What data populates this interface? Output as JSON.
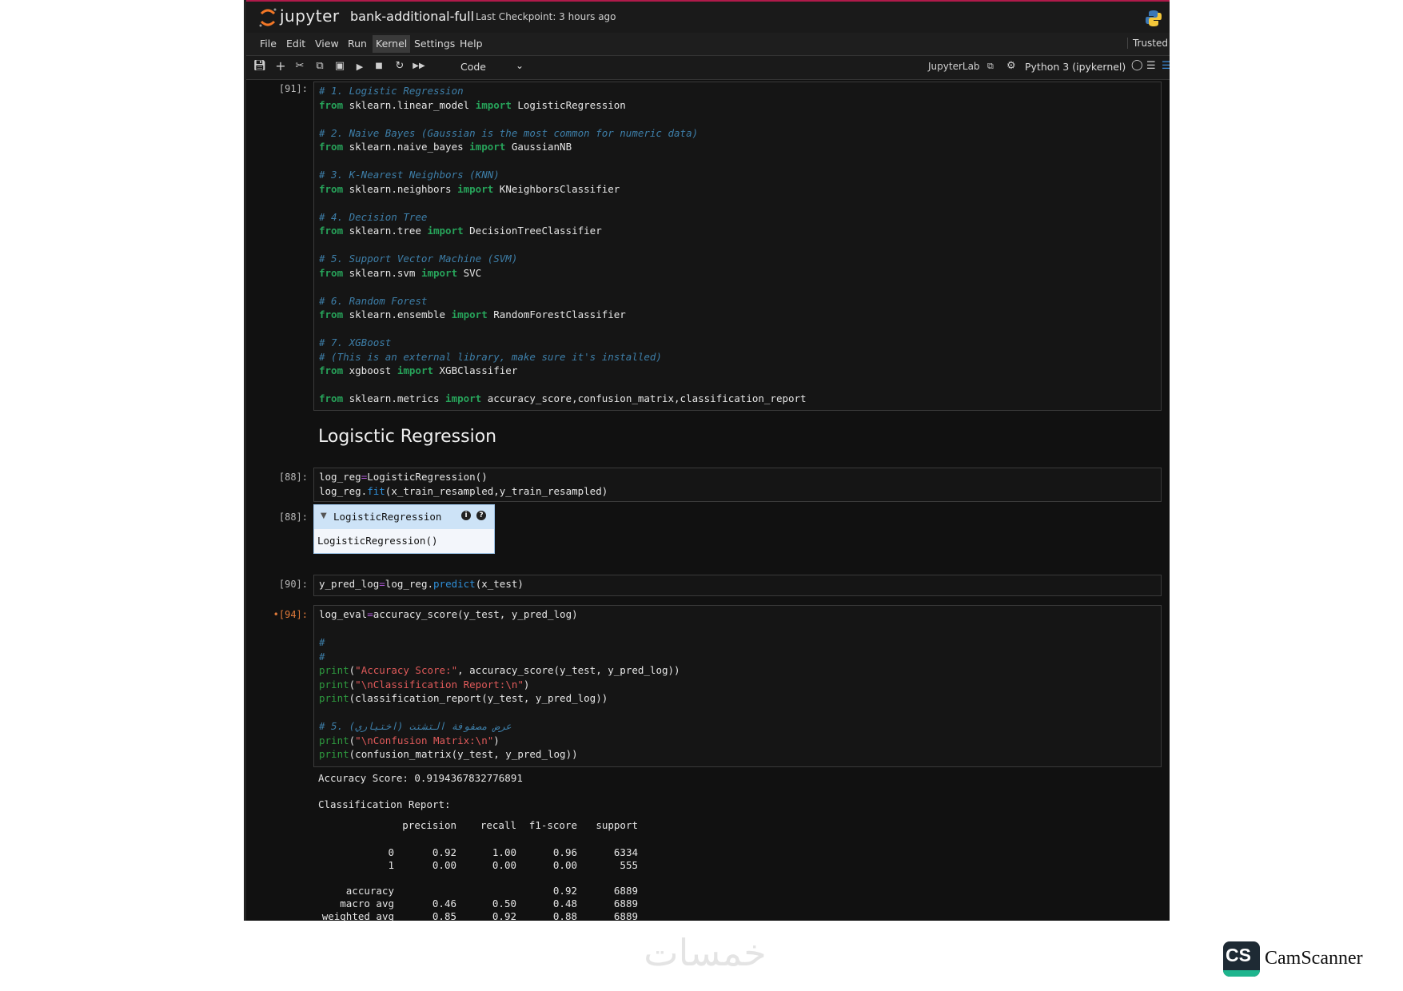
{
  "app": {
    "logo_text": "jupyter",
    "notebook_title": "bank-additional-full",
    "checkpoint": "Last Checkpoint: 3 hours ago",
    "trusted": "Trusted"
  },
  "menu": [
    "File",
    "Edit",
    "View",
    "Run",
    "Kernel",
    "Settings",
    "Help"
  ],
  "toolbar": {
    "cell_type": "Code",
    "jupyterlab_link": "JupyterLab",
    "kernel": "Python 3 (ipykernel)"
  },
  "icons": [
    "save-icon",
    "add-cell-icon",
    "cut-icon",
    "copy-icon",
    "paste-icon",
    "run-icon",
    "stop-icon",
    "restart-icon",
    "run-all-icon",
    "chevron-down-icon",
    "external-link-icon",
    "gear-icon",
    "kernel-status-icon",
    "menu-icon",
    "python-logo-icon"
  ],
  "cells": {
    "c91": {
      "prompt": "[91]:"
    },
    "heading": "Logisctic Regression",
    "c88": {
      "prompt": "[88]:",
      "out_prompt": "[88]:",
      "estimator_name": "LogisticRegression",
      "estimator_repr": "LogisticRegression()"
    },
    "c90": {
      "prompt": "[90]:"
    },
    "c94": {
      "prompt": "•[94]:"
    }
  },
  "output94": {
    "accuracy_line": "Accuracy Score: 0.9194367832776891",
    "report_title": "Classification Report:",
    "columns": [
      "",
      "precision",
      "recall",
      "f1-score",
      "support"
    ],
    "rows": [
      [
        "0",
        "0.92",
        "1.00",
        "0.96",
        "6334"
      ],
      [
        "1",
        "0.00",
        "0.00",
        "0.00",
        "555"
      ],
      [
        "",
        "",
        "",
        "",
        ""
      ],
      [
        "accuracy",
        "",
        "",
        "0.92",
        "6889"
      ],
      [
        "macro avg",
        "0.46",
        "0.50",
        "0.48",
        "6889"
      ],
      [
        "weighted avg",
        "0.85",
        "0.92",
        "0.88",
        "6889"
      ]
    ]
  },
  "footer": {
    "watermark": "خمسات",
    "camscanner_badge": "CS",
    "camscanner_text": "CamScanner"
  },
  "colors": {
    "background": "#111111",
    "comment": "#3d7ea8",
    "keyword": "#27a35a",
    "function": "#2f8fd8",
    "string": "#e05a5a",
    "estimator_header": "#cde3f7",
    "brand": "#f37726"
  }
}
